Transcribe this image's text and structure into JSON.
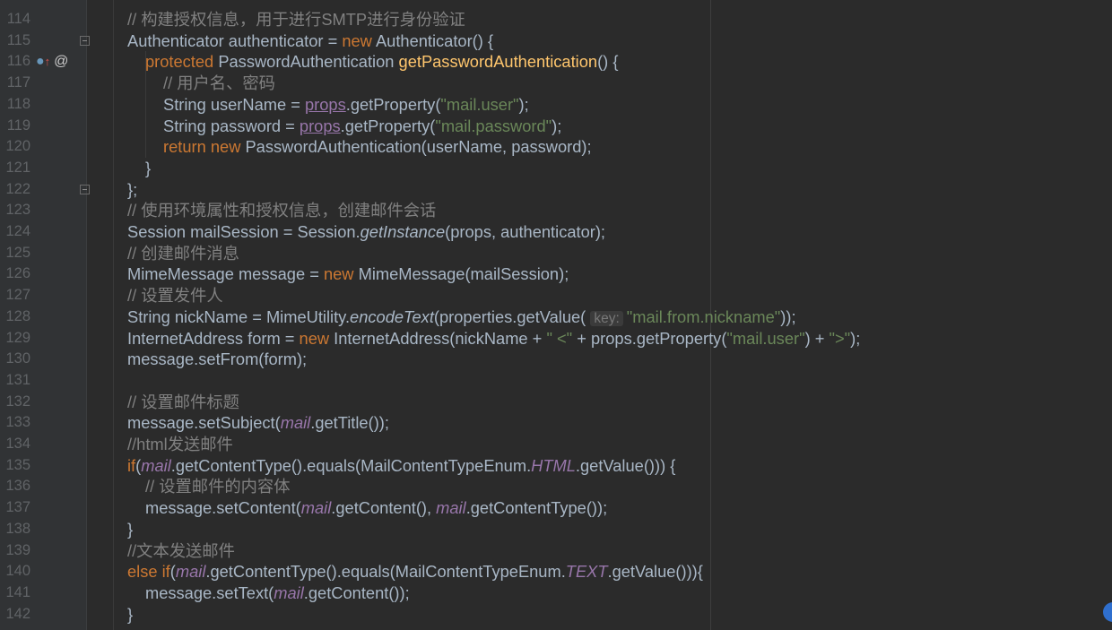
{
  "lines": [
    {
      "n": "114",
      "indent": 0,
      "tokens": [
        {
          "t": "// 构建授权信息，用于进行SMTP进行身份验证",
          "c": "comment"
        }
      ]
    },
    {
      "n": "115",
      "indent": 0,
      "fold": true,
      "tokens": [
        {
          "t": "Authenticator authenticator = "
        },
        {
          "t": "new",
          "c": "kw"
        },
        {
          "t": " Authenticator() {"
        }
      ]
    },
    {
      "n": "116",
      "indent": 1,
      "gutter_icons": true,
      "tokens": [
        {
          "t": "protected",
          "c": "kw"
        },
        {
          "t": " PasswordAuthentication "
        },
        {
          "t": "getPasswordAuthentication",
          "c": "method-decl"
        },
        {
          "t": "() {"
        }
      ]
    },
    {
      "n": "117",
      "indent": 2,
      "tokens": [
        {
          "t": "// 用户名、密码",
          "c": "comment"
        }
      ]
    },
    {
      "n": "118",
      "indent": 2,
      "tokens": [
        {
          "t": "String userName = "
        },
        {
          "t": "props",
          "c": "field-under"
        },
        {
          "t": ".getProperty("
        },
        {
          "t": "\"mail.user\"",
          "c": "str"
        },
        {
          "t": ");"
        }
      ]
    },
    {
      "n": "119",
      "indent": 2,
      "tokens": [
        {
          "t": "String password = "
        },
        {
          "t": "props",
          "c": "field-under"
        },
        {
          "t": ".getProperty("
        },
        {
          "t": "\"mail.password\"",
          "c": "str"
        },
        {
          "t": ");"
        }
      ]
    },
    {
      "n": "120",
      "indent": 2,
      "tokens": [
        {
          "t": "return",
          "c": "kw"
        },
        {
          "t": " "
        },
        {
          "t": "new",
          "c": "kw"
        },
        {
          "t": " PasswordAuthentication(userName, password);"
        }
      ]
    },
    {
      "n": "121",
      "indent": 1,
      "tokens": [
        {
          "t": "}"
        }
      ]
    },
    {
      "n": "122",
      "indent": 0,
      "fold": true,
      "tokens": [
        {
          "t": "};"
        }
      ]
    },
    {
      "n": "123",
      "indent": 0,
      "tokens": [
        {
          "t": "// 使用环境属性和授权信息，创建邮件会话",
          "c": "comment"
        }
      ]
    },
    {
      "n": "124",
      "indent": 0,
      "tokens": [
        {
          "t": "Session mailSession = Session."
        },
        {
          "t": "getInstance",
          "c": "italic"
        },
        {
          "t": "(props, authenticator);"
        }
      ]
    },
    {
      "n": "125",
      "indent": 0,
      "tokens": [
        {
          "t": "// 创建邮件消息",
          "c": "comment"
        }
      ]
    },
    {
      "n": "126",
      "indent": 0,
      "tokens": [
        {
          "t": "MimeMessage message = "
        },
        {
          "t": "new",
          "c": "kw"
        },
        {
          "t": " MimeMessage(mailSession);"
        }
      ]
    },
    {
      "n": "127",
      "indent": 0,
      "tokens": [
        {
          "t": "// 设置发件人",
          "c": "comment"
        }
      ]
    },
    {
      "n": "128",
      "indent": 0,
      "tokens": [
        {
          "t": "String nickName = MimeUtility."
        },
        {
          "t": "encodeText",
          "c": "italic"
        },
        {
          "t": "(properties.getValue( "
        },
        {
          "t": "key:",
          "c": "hint"
        },
        {
          "t": "\"mail.from.nickname\"",
          "c": "str"
        },
        {
          "t": "));"
        }
      ]
    },
    {
      "n": "129",
      "indent": 0,
      "tokens": [
        {
          "t": "InternetAddress form = "
        },
        {
          "t": "new",
          "c": "kw"
        },
        {
          "t": " InternetAddress(nickName + "
        },
        {
          "t": "\" <\"",
          "c": "str"
        },
        {
          "t": " + props.getProperty("
        },
        {
          "t": "\"mail.user\"",
          "c": "str"
        },
        {
          "t": ") + "
        },
        {
          "t": "\">\"",
          "c": "str"
        },
        {
          "t": ");"
        }
      ]
    },
    {
      "n": "130",
      "indent": 0,
      "tokens": [
        {
          "t": "message.setFrom(form);"
        }
      ]
    },
    {
      "n": "131",
      "indent": 0,
      "tokens": []
    },
    {
      "n": "132",
      "indent": 0,
      "tokens": [
        {
          "t": "// 设置邮件标题",
          "c": "comment"
        }
      ]
    },
    {
      "n": "133",
      "indent": 0,
      "tokens": [
        {
          "t": "message.setSubject("
        },
        {
          "t": "mail",
          "c": "field-italic"
        },
        {
          "t": ".getTitle());"
        }
      ]
    },
    {
      "n": "134",
      "indent": 0,
      "tokens": [
        {
          "t": "//html发送邮件",
          "c": "comment"
        }
      ]
    },
    {
      "n": "135",
      "indent": 0,
      "tokens": [
        {
          "t": "if",
          "c": "kw"
        },
        {
          "t": "("
        },
        {
          "t": "mail",
          "c": "field-italic"
        },
        {
          "t": ".getContentType().equals(MailContentTypeEnum."
        },
        {
          "t": "HTML",
          "c": "field-italic"
        },
        {
          "t": ".getValue())) {"
        }
      ]
    },
    {
      "n": "136",
      "indent": 1,
      "tokens": [
        {
          "t": "// 设置邮件的内容体",
          "c": "comment"
        }
      ]
    },
    {
      "n": "137",
      "indent": 1,
      "tokens": [
        {
          "t": "message.setContent("
        },
        {
          "t": "mail",
          "c": "field-italic"
        },
        {
          "t": ".getContent(), "
        },
        {
          "t": "mail",
          "c": "field-italic"
        },
        {
          "t": ".getContentType());"
        }
      ]
    },
    {
      "n": "138",
      "indent": 0,
      "tokens": [
        {
          "t": "}"
        }
      ]
    },
    {
      "n": "139",
      "indent": 0,
      "tokens": [
        {
          "t": "//文本发送邮件",
          "c": "comment"
        }
      ]
    },
    {
      "n": "140",
      "indent": 0,
      "tokens": [
        {
          "t": "else if",
          "c": "kw"
        },
        {
          "t": "("
        },
        {
          "t": "mail",
          "c": "field-italic"
        },
        {
          "t": ".getContentType().equals(MailContentTypeEnum."
        },
        {
          "t": "TEXT",
          "c": "field-italic"
        },
        {
          "t": ".getValue())){"
        }
      ]
    },
    {
      "n": "141",
      "indent": 1,
      "tokens": [
        {
          "t": "message.setText("
        },
        {
          "t": "mail",
          "c": "field-italic"
        },
        {
          "t": ".getContent());"
        }
      ]
    },
    {
      "n": "142",
      "indent": 0,
      "tokens": [
        {
          "t": "}"
        }
      ]
    }
  ],
  "gutter": {
    "override_icon": "override-method-icon",
    "annotation_icon": "at-sign-icon",
    "at_glyph": "@",
    "arrow_glyph": "↑",
    "circle_glyph": "●"
  },
  "colors": {
    "background": "#2b2b2b",
    "gutter": "#313335",
    "keyword": "#cc7832",
    "string": "#6a8759",
    "comment": "#808080",
    "field": "#9876aa",
    "method": "#ffc66d"
  }
}
